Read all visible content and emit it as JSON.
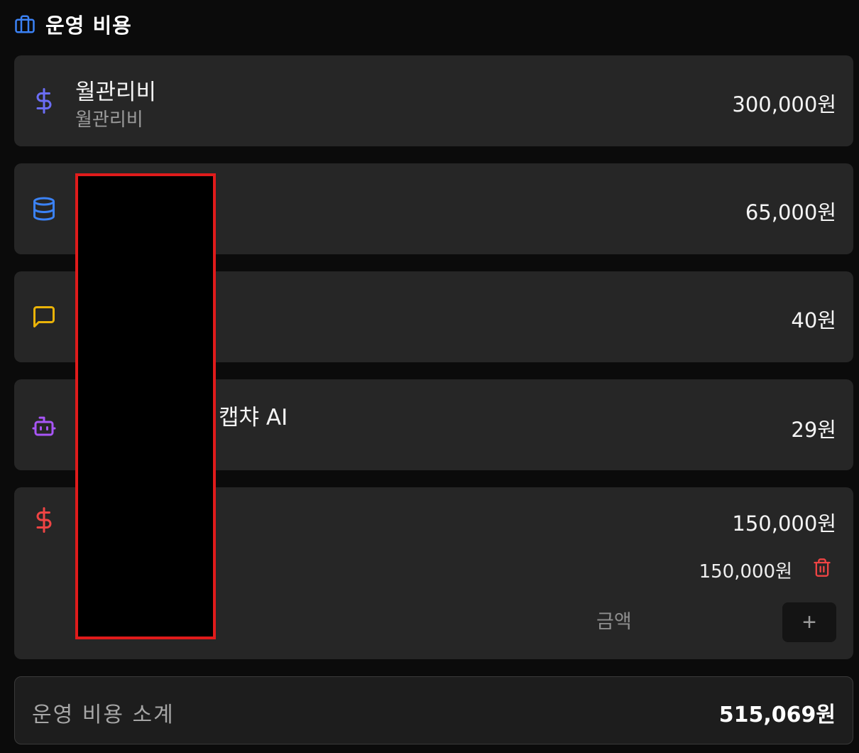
{
  "section": {
    "title": "운영 비용",
    "icon": "briefcase-icon"
  },
  "items": [
    {
      "icon": "dollar-icon",
      "icon_color": "#6b6df5",
      "name": "월관리비",
      "sub": "월관리비",
      "amount": "300,000원"
    },
    {
      "icon": "database-icon",
      "icon_color": "#3b82f6",
      "name": "",
      "sub": "",
      "amount": "65,000원"
    },
    {
      "icon": "message-square-icon",
      "icon_color": "#eab308",
      "name": "",
      "sub": "",
      "amount": "40원"
    },
    {
      "icon": "bot-icon",
      "icon_color": "#a855f7",
      "name": "캡챠 AI",
      "sub": "",
      "amount": "29원"
    },
    {
      "icon": "dollar-icon",
      "icon_color": "#ef4444",
      "name": "",
      "sub": "",
      "amount": "150,000원",
      "entries": [
        {
          "amount": "150,000원",
          "delete_icon": "trash-icon"
        }
      ],
      "input_placeholder": "금액",
      "add_button": "+"
    }
  ],
  "subtotal": {
    "label": "운영 비용 소계",
    "value": "515,069원"
  },
  "colors": {
    "background": "#0b0b0b",
    "card": "#262626",
    "header_icon": "#3b82f6",
    "redaction_border": "#e01b1b",
    "delete": "#ef4444"
  }
}
